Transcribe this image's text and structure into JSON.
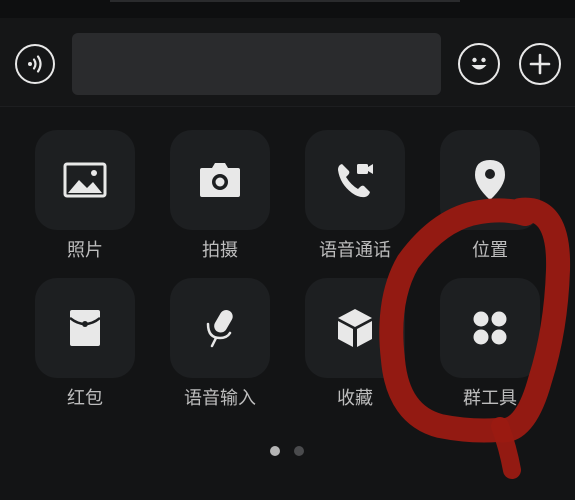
{
  "input_bar": {
    "voice_icon": "voice-input-icon",
    "emoji_icon": "smiley-icon",
    "plus_icon": "plus-icon",
    "text_value": ""
  },
  "grid": {
    "items": [
      {
        "label": "照片",
        "icon": "image-icon"
      },
      {
        "label": "拍摄",
        "icon": "camera-icon"
      },
      {
        "label": "语音通话",
        "icon": "phone-video-icon"
      },
      {
        "label": "位置",
        "icon": "location-pin-icon"
      },
      {
        "label": "红包",
        "icon": "red-envelope-icon"
      },
      {
        "label": "语音输入",
        "icon": "microphone-icon"
      },
      {
        "label": "收藏",
        "icon": "cube-icon"
      },
      {
        "label": "群工具",
        "icon": "four-dots-icon"
      }
    ]
  },
  "pager": {
    "current_page": 1,
    "total_pages": 2
  },
  "colors": {
    "background": "#131415",
    "tile": "#1d1f21",
    "icon": "#e8e8e8",
    "label": "#bdbdbd",
    "annotation": "#9a1a12"
  }
}
